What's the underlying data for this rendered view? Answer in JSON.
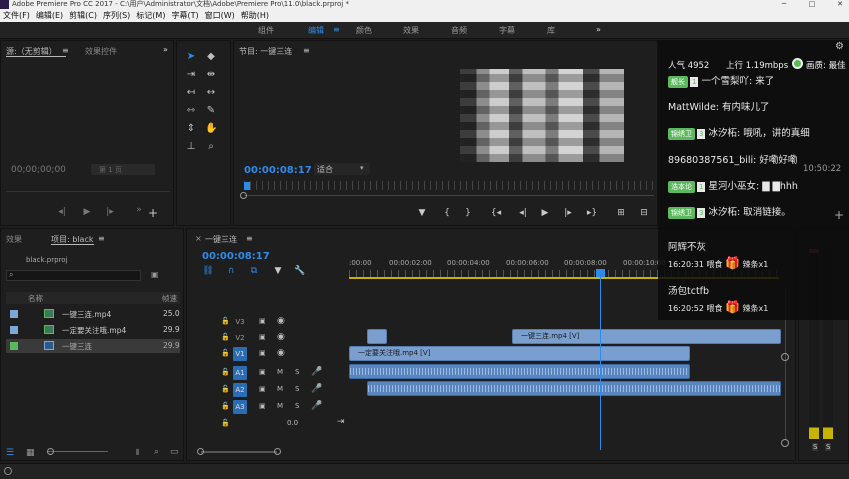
{
  "window": {
    "title": "Adobe Premiere Pro CC 2017 - C:\\用户\\Administrator\\文档\\Adobe\\Premiere Pro\\11.0\\black.prproj *"
  },
  "menu": [
    "文件(F)",
    "编辑(E)",
    "剪辑(C)",
    "序列(S)",
    "标记(M)",
    "字幕(T)",
    "窗口(W)",
    "帮助(H)"
  ],
  "workspaces": {
    "items": [
      "组件",
      "编辑",
      "颜色",
      "效果",
      "音频",
      "字幕",
      "库"
    ],
    "active": "编辑",
    "more": "»"
  },
  "source_panel": {
    "tab": "源:（无剪辑）",
    "tab2": "效果控件",
    "timecode": "00;00;00;00",
    "page": "第 1 页"
  },
  "program_monitor": {
    "tab": "节目: 一键三连",
    "timecode": "00:00:08:17",
    "fit": "适合"
  },
  "project_panel": {
    "tab1": "效果",
    "tab2": "项目: black",
    "file": "black.prproj",
    "col_name": "名称",
    "col_fps": "帧速",
    "items": [
      {
        "name": "一键三连.mp4",
        "fps": "25.0",
        "color": "#7fa7d6"
      },
      {
        "name": "一定要关注哦.mp4",
        "fps": "29.9",
        "color": "#7fa7d6"
      },
      {
        "name": "一键三连",
        "fps": "29.9",
        "color": "#5cb85c"
      }
    ]
  },
  "timeline": {
    "tab": "一键三连",
    "timecode": "00:00:08:17",
    "ruler": [
      ":00:00",
      "00:00:02:00",
      "00:00:04:00",
      "00:00:06:00",
      "00:00:08:00",
      "00:00:10:00"
    ],
    "tracks": [
      {
        "name": "V3",
        "on": false
      },
      {
        "name": "V2",
        "on": false
      },
      {
        "name": "V1",
        "on": true
      },
      {
        "name": "A1",
        "on": true
      },
      {
        "name": "A2",
        "on": true
      },
      {
        "name": "A3",
        "on": true
      }
    ],
    "mute": "M",
    "solo": "S",
    "volume": "0.0",
    "clip_v2": "一键三连.mp4 [V]",
    "clip_v1": "一定要关注哦.mp4 [V]"
  },
  "stream_overlay": {
    "popularity": "人气 4952",
    "upload": "上行 1.19mbps",
    "quality": "画质: 最佳",
    "time": "10:50:22",
    "messages": [
      {
        "badge": "舰长",
        "level": "1",
        "text": "一个雪梨吖: 来了"
      },
      {
        "badge": "",
        "level": "",
        "text": "MattWilde: 有内味儿了"
      },
      {
        "badge": "锦绣卫",
        "level": "3",
        "text": "冰汐柘: 哦吼，讲的真细"
      },
      {
        "badge": "",
        "level": "",
        "text": "89680387561_bili: 好嘞好嘞"
      },
      {
        "badge": "浩本论",
        "level": "1",
        "text": "星河小巫女: ▇  ▇hhh"
      },
      {
        "badge": "锦绣卫",
        "level": "3",
        "text": "冰汐柘: 取消链接。"
      }
    ],
    "gifts": [
      {
        "user": "阿辉不灰",
        "time": "16:20:31",
        "action": "喂食",
        "item": "辣条x1"
      },
      {
        "user": "汤包tctfb",
        "time": "16:20:52",
        "action": "喂食",
        "item": "辣条x1"
      }
    ],
    "accent": "#5cb85c"
  },
  "meter": {
    "labels": [
      "S",
      "S"
    ]
  }
}
